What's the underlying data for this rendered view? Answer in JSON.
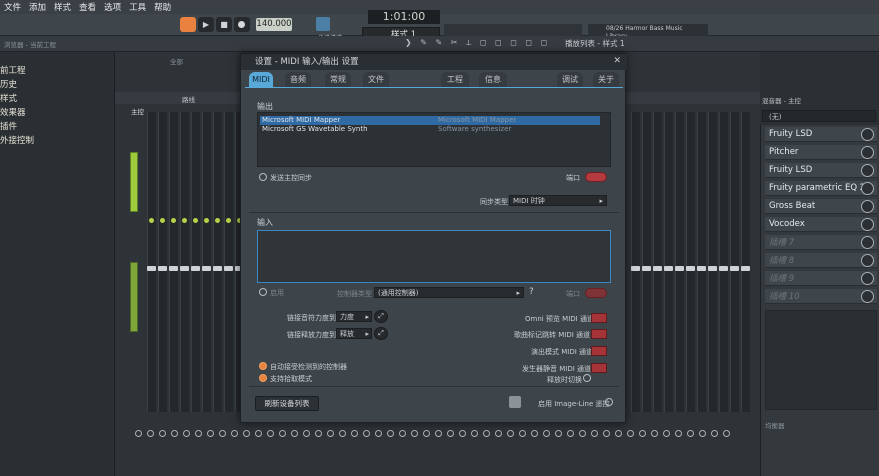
{
  "menu": [
    "文件",
    "添加",
    "样式",
    "查看",
    "选项",
    "工具",
    "帮助"
  ],
  "transport": {
    "tempo": "140.000",
    "time": "1:01:00",
    "pattern": "样式 1",
    "snap": "步进",
    "step_label": "步进模式"
  },
  "news": {
    "line1": "08/26  Harmor Bass Music",
    "line2": "Library"
  },
  "toolbar2": {
    "left": "浏览器 - 当前工程",
    "playlist": "播放列表 - 样式 1",
    "all": "全部"
  },
  "browser": {
    "items": [
      "前工程",
      "历史",
      "样式",
      "效果器",
      "插件",
      "外接控制"
    ]
  },
  "mixer": {
    "label": "主控",
    "preset": "混音器 - 主控",
    "input_label": "(无)",
    "routing": "路线",
    "channel": "混音",
    "bottom": "均衡器"
  },
  "dialog": {
    "title": "设置 - MIDI 输入/输出 设置",
    "tabs": [
      "MIDI",
      "音频",
      "常规",
      "文件",
      "工程",
      "信息",
      "调试",
      "关于"
    ],
    "output_label": "输出",
    "outputs": [
      {
        "name": "Microsoft MIDI Mapper",
        "port": "Microsoft MIDI Mapper",
        "selected": true
      },
      {
        "name": "Microsoft GS Wavetable Synth",
        "port": "Software synthesizer",
        "selected": false
      }
    ],
    "send_master_sync": "发送主控同步",
    "port_label": "端口",
    "sync_type_label": "同步类型",
    "sync_type_value": "MIDI 时钟",
    "input_label": "输入",
    "enable_label": "启用",
    "controller_type_label": "控制器类型",
    "controller_type_value": "(通用控制器)",
    "help": "?",
    "port2_label": "端口",
    "link_note_on": "链接音符力度到",
    "link_note_on_value": "力度",
    "link_note_off": "链接释放力度到",
    "link_note_off_value": "释放",
    "auto_accept": "自动接受检测到的控制器",
    "pickup": "支持拾取模式",
    "omni_preview": "Omni 预览 MIDI 通道",
    "song_marker": "歌曲标记跳转 MIDI 通道",
    "performance": "演出模式 MIDI 通道",
    "generator_mute": "发生器静音 MIDI 通道",
    "release_toggle": "释放时切换",
    "refresh": "刷新设备列表",
    "imageline_remote": "启用 Image-Line 遥控"
  },
  "plugins": {
    "slots": [
      {
        "name": "Fruity LSD",
        "active": true
      },
      {
        "name": "Pitcher",
        "active": true
      },
      {
        "name": "Fruity LSD",
        "active": true
      },
      {
        "name": "Fruity parametric EQ 2",
        "active": true
      },
      {
        "name": "Gross Beat",
        "active": true
      },
      {
        "name": "Vocodex",
        "active": true
      },
      {
        "name": "插槽 7",
        "active": false
      },
      {
        "name": "插槽 8",
        "active": false
      },
      {
        "name": "插槽 9",
        "active": false
      },
      {
        "name": "插槽 10",
        "active": false
      }
    ]
  },
  "colors": {
    "accent": "#59a9d8",
    "record": "#e8823e",
    "toggle_red": "#b53a3f",
    "selected_row": "#2f6aa5"
  }
}
